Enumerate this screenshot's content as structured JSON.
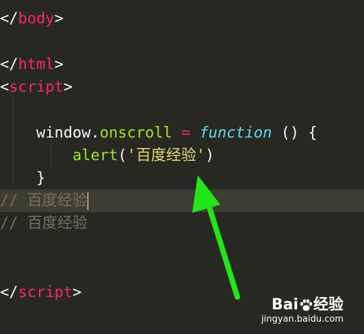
{
  "code": {
    "l1": {
      "open": "</",
      "tag": "body",
      "close": ">"
    },
    "l2": {
      "open": "</",
      "tag": "html",
      "close": ">"
    },
    "l3": {
      "open": "<",
      "tag": "script",
      "close": ">"
    },
    "l4": {
      "indent": "    ",
      "object": "window",
      "dot": ".",
      "prop": "onscroll",
      "sp1": " ",
      "eq": "=",
      "sp2": " ",
      "kw": "function",
      "rest": " () {"
    },
    "l5": {
      "indent": "        ",
      "fn": "alert",
      "open": "(",
      "str": "'百度经验'",
      "close": ")"
    },
    "l6": {
      "indent": "    ",
      "brace": "}"
    },
    "l7": {
      "comment": "// 百度经验"
    },
    "l8": {
      "comment": "// 百度经验"
    },
    "l9": {
      "open": "</",
      "tag": "script",
      "close": ">"
    }
  },
  "watermark": {
    "brand": "Bai",
    "brand2": "经验",
    "url": "jingyan.baidu.com"
  },
  "colors": {
    "background": "#272822",
    "active_line": "#3e3d32",
    "tag": "#f92672",
    "keyword": "#66d9ef",
    "function_name": "#a6e22e",
    "string": "#e6db74",
    "comment": "#75715e",
    "arrow": "#22e51a"
  },
  "icons": {
    "arrow": "green-arrow-icon",
    "paw": "baidu-paw-icon"
  }
}
